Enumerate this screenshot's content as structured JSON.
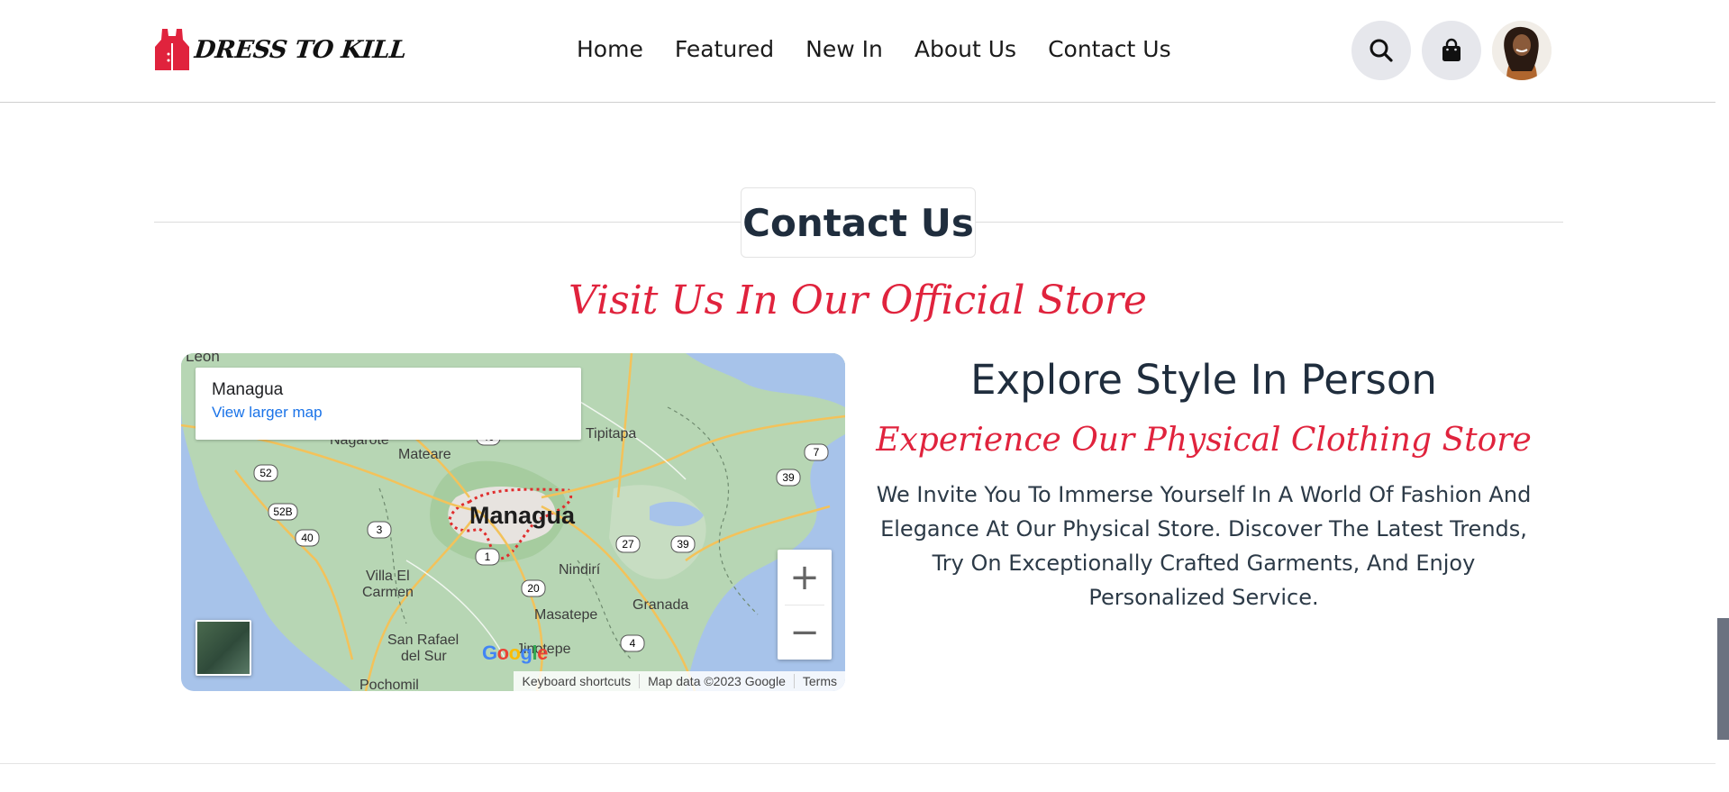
{
  "brand": {
    "name": "DRESS TO KILL",
    "accent": "#e0233d"
  },
  "nav": {
    "items": [
      "Home",
      "Featured",
      "New In",
      "About Us",
      "Contact Us"
    ]
  },
  "header": {
    "search_icon": "search-icon",
    "cart_icon": "shopping-bag-icon",
    "avatar": "user-avatar"
  },
  "section": {
    "title": "Contact Us",
    "subtitle": "Visit Us In Our Official Store"
  },
  "map": {
    "place": "Managua",
    "larger_link": "View larger map",
    "zoom_in": "+",
    "zoom_out": "−",
    "attribution": [
      "Keyboard shortcuts",
      "Map data ©2023 Google",
      "Terms"
    ],
    "labels": [
      "León",
      "Nagarote",
      "Mateare",
      "Tipitapa",
      "Managua",
      "Villa El",
      "Carmen",
      "Nindirí",
      "Masatepe",
      "Granada",
      "San Rafael",
      "del Sur",
      "Jinotepe",
      "Pochomil"
    ],
    "shields": [
      "52",
      "52B",
      "40",
      "3",
      "1",
      "20",
      "27",
      "39",
      "4",
      "7",
      "39",
      "40"
    ],
    "google": "Google"
  },
  "store": {
    "heading": "Explore Style In Person",
    "tagline": "Experience Our Physical Clothing Store",
    "description": "We Invite You To Immerse Yourself In A World Of Fashion And Elegance At Our Physical Store. Discover The Latest Trends, Try On Exceptionally Crafted Garments, And Enjoy Personalized Service."
  }
}
